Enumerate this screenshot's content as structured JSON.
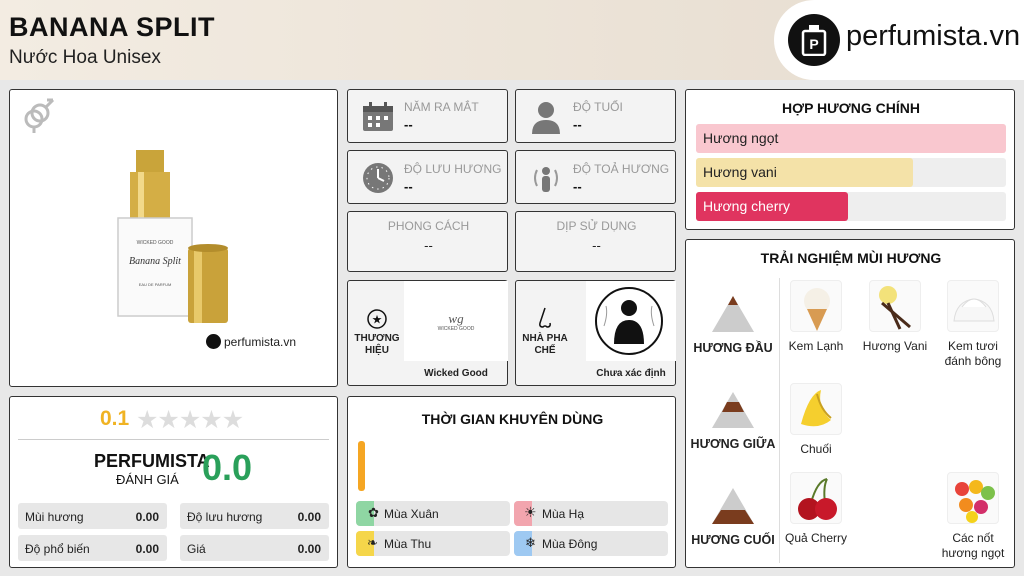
{
  "header": {
    "title": "BANANA SPLIT",
    "subtitle": "Nước Hoa Unisex",
    "logo_text": "perfumista.vn"
  },
  "product": {
    "gender_icon": "unisex-icon",
    "watermark": "perfumista.vn",
    "bottle_brand": "WICKED GOOD",
    "bottle_name": "Banana Split",
    "bottle_type": "EAU DE PARFUM"
  },
  "info": {
    "release": {
      "label": "NĂM RA MẮT",
      "value": "--"
    },
    "age": {
      "label": "ĐỘ TUỔI",
      "value": "--"
    },
    "longevity": {
      "label": "ĐỘ LƯU HƯƠNG",
      "value": "--"
    },
    "sillage": {
      "label": "ĐỘ TOẢ HƯƠNG",
      "value": "--"
    },
    "style": {
      "label": "PHONG CÁCH",
      "value": "--"
    },
    "occasion": {
      "label": "DỊP SỬ DỤNG",
      "value": "--"
    },
    "brand": {
      "label_1": "THƯƠNG",
      "label_2": "HIỆU",
      "name": "Wicked Good",
      "logo_text": "WICKED GOOD"
    },
    "perfumer": {
      "label_1": "NHÀ PHA",
      "label_2": "CHẾ",
      "name": "Chưa xác định"
    }
  },
  "accords": {
    "title": "HỢP HƯƠNG CHÍNH",
    "items": [
      {
        "label": "Hương ngọt",
        "fill": 1.0,
        "color": "#f9c7cf"
      },
      {
        "label": "Hương vani",
        "fill": 0.7,
        "color": "#f4e2a8"
      },
      {
        "label": "Hương cherry",
        "fill": 0.49,
        "color": "#e0345f"
      }
    ]
  },
  "rating": {
    "score": "0.1",
    "stars": 5,
    "brand": "PERFUMISTA",
    "eval": "ĐÁNH GIÁ",
    "big_score": "0.0",
    "cells": [
      {
        "label": "Mùi hương",
        "value": "0.00"
      },
      {
        "label": "Độ lưu hương",
        "value": "0.00"
      },
      {
        "label": "Độ phổ biến",
        "value": "0.00"
      },
      {
        "label": "Giá",
        "value": "0.00"
      }
    ]
  },
  "season": {
    "title": "THỜI GIAN KHUYÊN DÙNG",
    "items": [
      {
        "label": "Mùa Xuân",
        "color": "#8fd6a3",
        "icon": "flower-icon"
      },
      {
        "label": "Mùa Hạ",
        "color": "#f2a5ae",
        "icon": "sun-icon"
      },
      {
        "label": "Mùa Thu",
        "color": "#f5d64a",
        "icon": "leaf-icon"
      },
      {
        "label": "Mùa Đông",
        "color": "#9ec9f2",
        "icon": "snowflake-icon"
      }
    ],
    "day_bar_color": "#f5a623"
  },
  "notes": {
    "title": "TRẢI NGHIỆM MÙI HƯƠNG",
    "top": {
      "label": "HƯƠNG ĐẦU",
      "items": [
        "Kem Lạnh",
        "Hương Vani",
        "Kem tươi đánh bông"
      ]
    },
    "middle": {
      "label": "HƯƠNG GIỮA",
      "items": [
        "Chuối"
      ]
    },
    "base": {
      "label": "HƯƠNG CUỐI",
      "items": [
        "Quả Cherry",
        "Các nốt hương ngọt"
      ]
    }
  }
}
